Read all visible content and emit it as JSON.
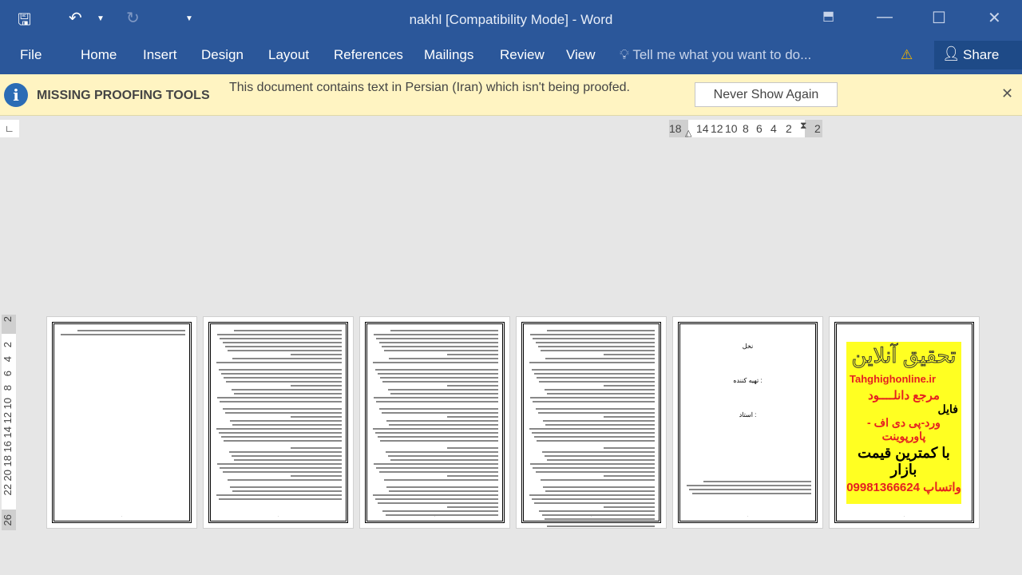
{
  "window": {
    "title": "nakhl [Compatibility Mode] - Word"
  },
  "ribbon": {
    "tabs": [
      "File",
      "Home",
      "Insert",
      "Design",
      "Layout",
      "References",
      "Mailings",
      "Review",
      "View"
    ],
    "tell_me": "Tell me what you want to do...",
    "share": "Share"
  },
  "message_bar": {
    "title": "MISSING PROOFING TOOLS",
    "text": "This document contains text in Persian (Iran) which isn't being proofed.",
    "button": "Never Show Again"
  },
  "ruler": {
    "horizontal": [
      "18",
      "14",
      "12",
      "10",
      "8",
      "6",
      "4",
      "2",
      "2"
    ],
    "vertical": [
      "2",
      "2",
      "4",
      "6",
      "8",
      "10",
      "12",
      "14",
      "16",
      "18",
      "20",
      "22",
      "26"
    ]
  },
  "pages": {
    "title_page": {
      "title": "نخل",
      "prepared_by": "تهیه کننده :",
      "teacher": "استاد :"
    },
    "ad": {
      "title": "تحقیق آنلاین",
      "site": "Tahghighonline.ir",
      "line1": "مرجع دانلــــود",
      "line2": "فایل",
      "line3": "ورد-پی دی اف - پاورپوینت",
      "line4": "با کمترین قیمت بازار",
      "phone": "09981366624",
      "whatsapp": "واتساپ"
    }
  },
  "colors": {
    "title_bar": "#2b579a",
    "message_bar": "#fff4c2",
    "ad_background": "#ffff22"
  }
}
